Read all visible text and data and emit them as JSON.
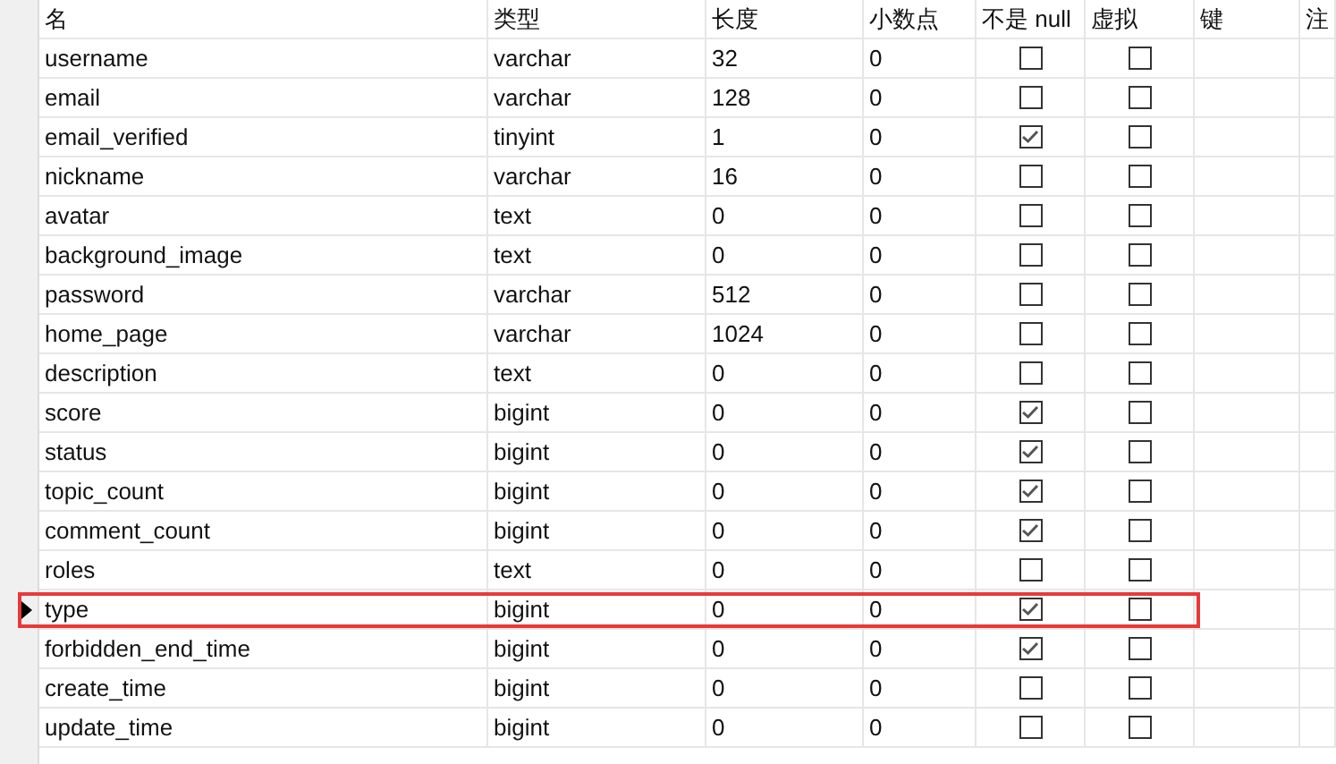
{
  "columns": [
    "名",
    "类型",
    "长度",
    "小数点",
    "不是 null",
    "虚拟",
    "键",
    "注"
  ],
  "rows": [
    {
      "name": "username",
      "type": "varchar",
      "length": "32",
      "decimals": "0",
      "not_null": false,
      "virtual": false,
      "selected": false
    },
    {
      "name": "email",
      "type": "varchar",
      "length": "128",
      "decimals": "0",
      "not_null": false,
      "virtual": false,
      "selected": false
    },
    {
      "name": "email_verified",
      "type": "tinyint",
      "length": "1",
      "decimals": "0",
      "not_null": true,
      "virtual": false,
      "selected": false
    },
    {
      "name": "nickname",
      "type": "varchar",
      "length": "16",
      "decimals": "0",
      "not_null": false,
      "virtual": false,
      "selected": false
    },
    {
      "name": "avatar",
      "type": "text",
      "length": "0",
      "decimals": "0",
      "not_null": false,
      "virtual": false,
      "selected": false
    },
    {
      "name": "background_image",
      "type": "text",
      "length": "0",
      "decimals": "0",
      "not_null": false,
      "virtual": false,
      "selected": false
    },
    {
      "name": "password",
      "type": "varchar",
      "length": "512",
      "decimals": "0",
      "not_null": false,
      "virtual": false,
      "selected": false
    },
    {
      "name": "home_page",
      "type": "varchar",
      "length": "1024",
      "decimals": "0",
      "not_null": false,
      "virtual": false,
      "selected": false
    },
    {
      "name": "description",
      "type": "text",
      "length": "0",
      "decimals": "0",
      "not_null": false,
      "virtual": false,
      "selected": false
    },
    {
      "name": "score",
      "type": "bigint",
      "length": "0",
      "decimals": "0",
      "not_null": true,
      "virtual": false,
      "selected": false
    },
    {
      "name": "status",
      "type": "bigint",
      "length": "0",
      "decimals": "0",
      "not_null": true,
      "virtual": false,
      "selected": false
    },
    {
      "name": "topic_count",
      "type": "bigint",
      "length": "0",
      "decimals": "0",
      "not_null": true,
      "virtual": false,
      "selected": false
    },
    {
      "name": "comment_count",
      "type": "bigint",
      "length": "0",
      "decimals": "0",
      "not_null": true,
      "virtual": false,
      "selected": false
    },
    {
      "name": "roles",
      "type": "text",
      "length": "0",
      "decimals": "0",
      "not_null": false,
      "virtual": false,
      "selected": false
    },
    {
      "name": "type",
      "type": "bigint",
      "length": "0",
      "decimals": "0",
      "not_null": true,
      "virtual": false,
      "selected": true
    },
    {
      "name": "forbidden_end_time",
      "type": "bigint",
      "length": "0",
      "decimals": "0",
      "not_null": true,
      "virtual": false,
      "selected": false
    },
    {
      "name": "create_time",
      "type": "bigint",
      "length": "0",
      "decimals": "0",
      "not_null": false,
      "virtual": false,
      "selected": false
    },
    {
      "name": "update_time",
      "type": "bigint",
      "length": "0",
      "decimals": "0",
      "not_null": false,
      "virtual": false,
      "selected": false
    }
  ]
}
